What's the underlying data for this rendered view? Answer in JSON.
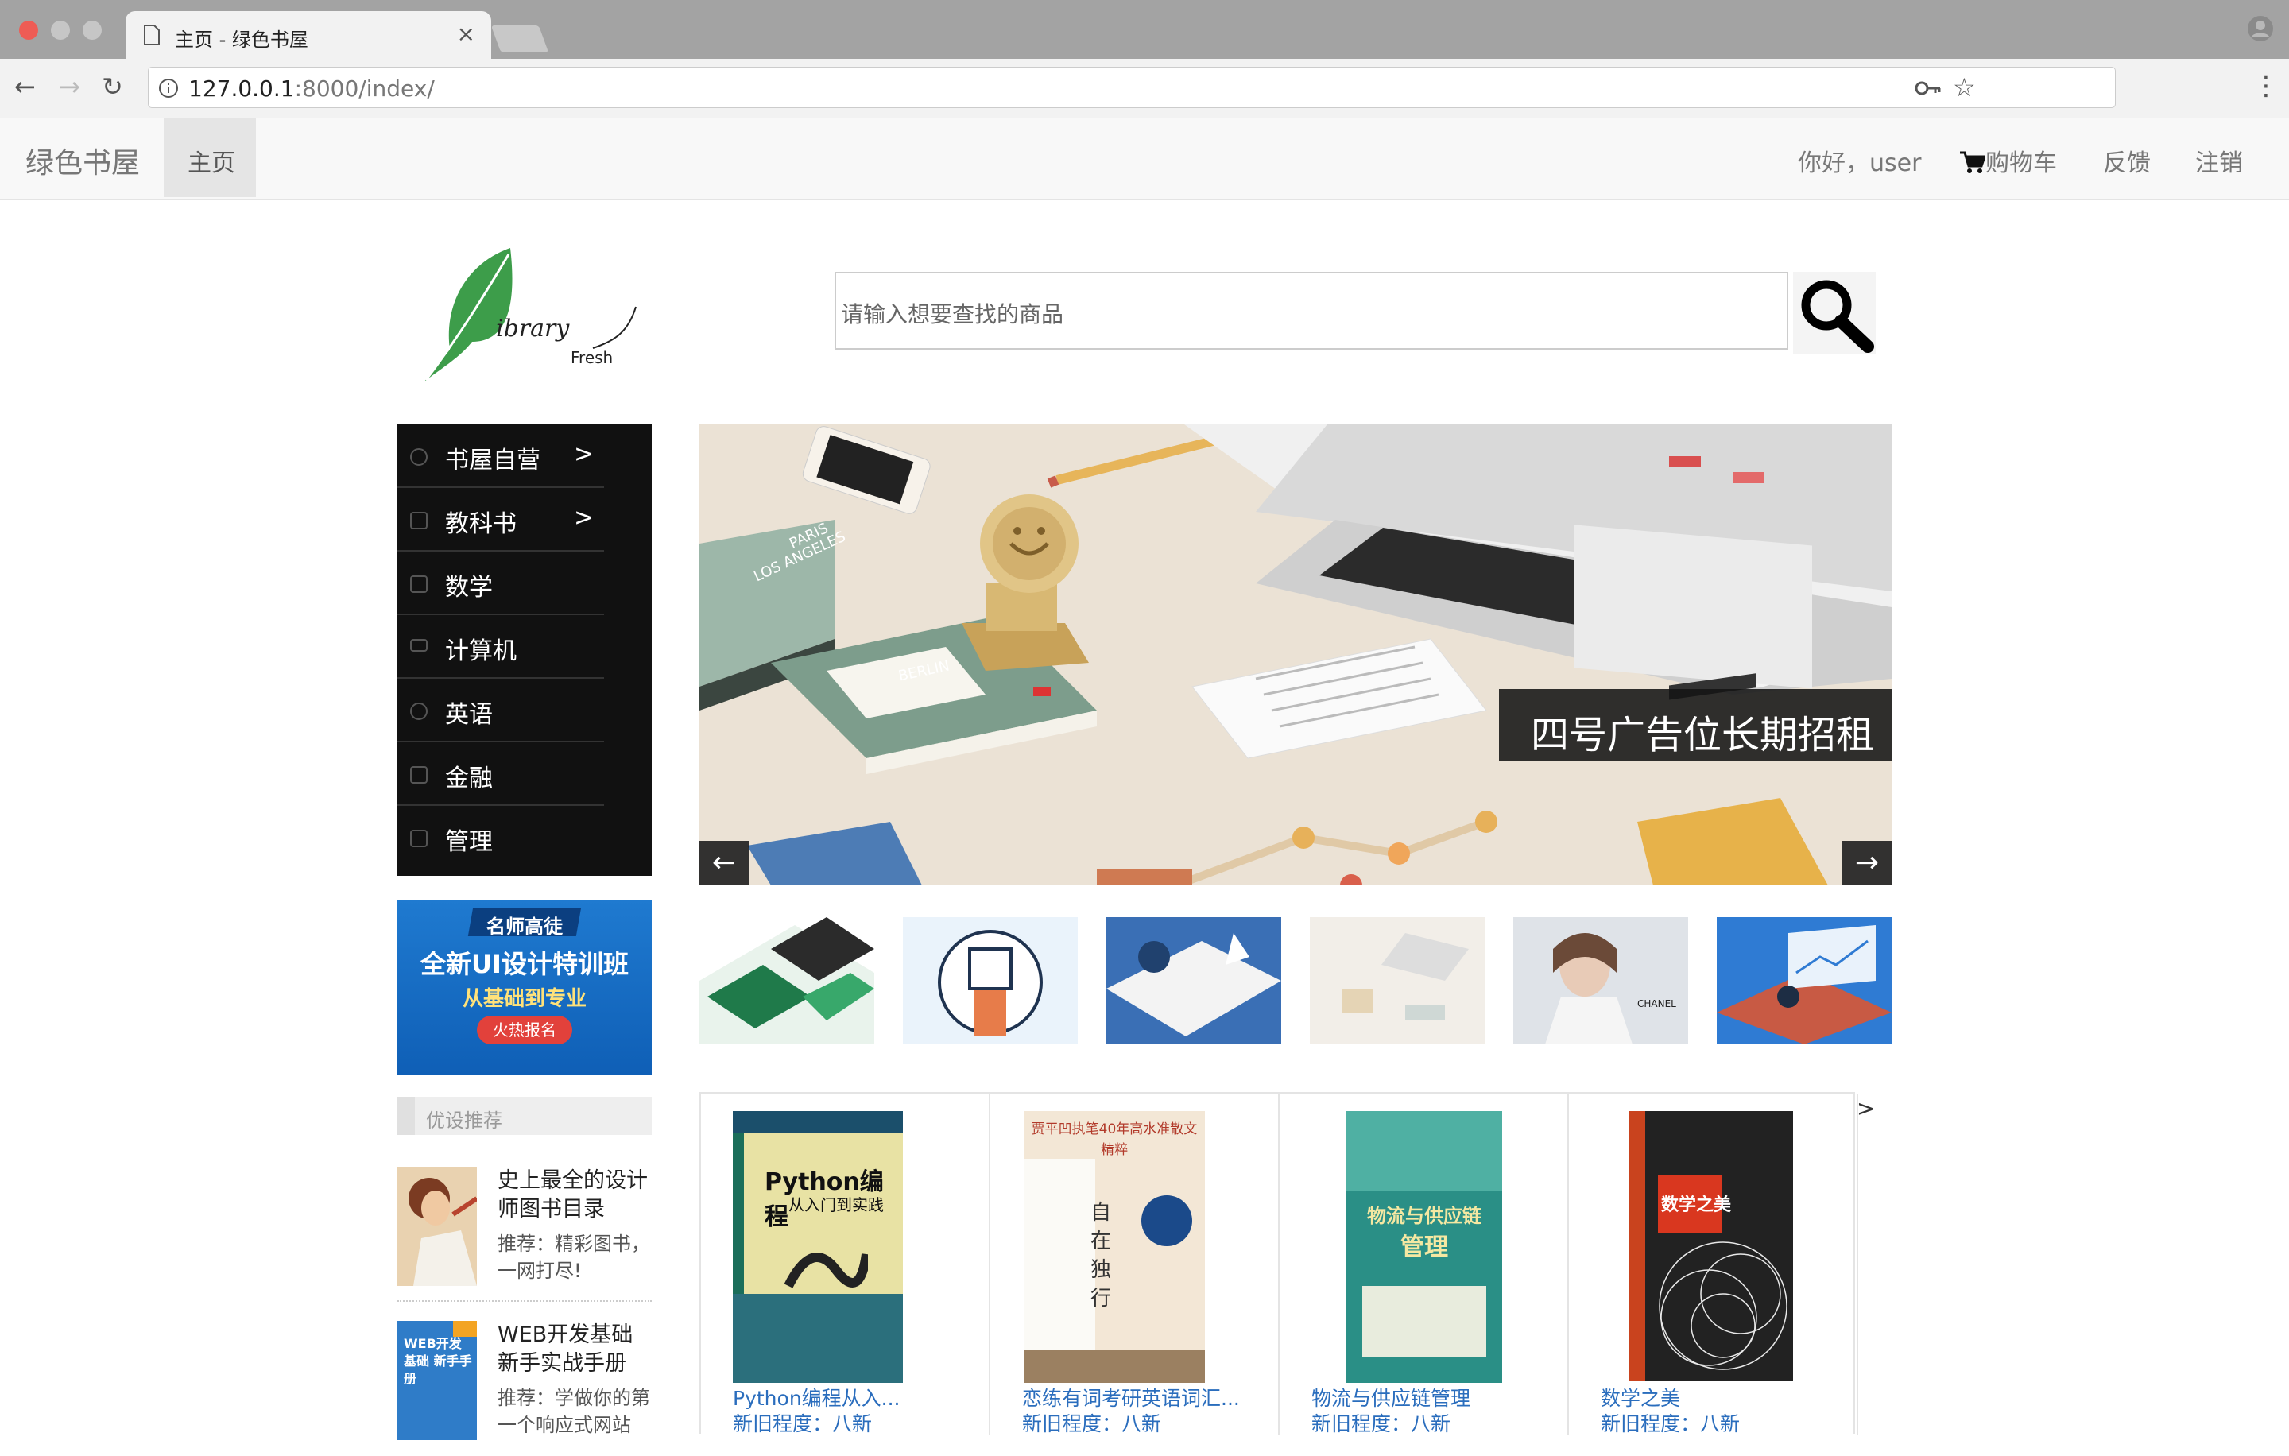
{
  "browser": {
    "tab_title": "主页 - 绿色书屋",
    "url_host": "127.0.0.1",
    "url_rest": ":8000/index/"
  },
  "navbar": {
    "brand": "绿色书屋",
    "home": "主页",
    "greeting": "你好，user",
    "cart": "购物车",
    "feedback": "反馈",
    "logout": "注销"
  },
  "logo": {
    "word": "ibrary",
    "sub": "Fresh"
  },
  "search": {
    "placeholder": "请输入想要查找的商品"
  },
  "categories": [
    {
      "label": "书屋自营",
      "arrow": ">"
    },
    {
      "label": "教科书",
      "arrow": ">"
    },
    {
      "label": "数学",
      "arrow": ""
    },
    {
      "label": "计算机",
      "arrow": ""
    },
    {
      "label": "英语",
      "arrow": ""
    },
    {
      "label": "金融",
      "arrow": ""
    },
    {
      "label": "管理",
      "arrow": ""
    }
  ],
  "promo": {
    "line1": "名师高徒",
    "line2": "全新UI设计特训班",
    "line3": "从基础到专业",
    "button": "火热报名"
  },
  "recommend": {
    "header": "优设推荐",
    "items": [
      {
        "title": "史上最全的设计师图书目录",
        "desc": "推荐：精彩图书，一网打尽!"
      },
      {
        "title": "WEB开发基础新手实战手册",
        "desc": "推荐：学做你的第一个响应式网站",
        "img_text": "WEB开发基础 新手手册"
      }
    ]
  },
  "carousel": {
    "caption": "四号广告位长期招租",
    "prev": "←",
    "next": "→",
    "scene_labels": [
      "PARIS",
      "LOS ANGELES",
      "BERLIN"
    ]
  },
  "thumbnails": [
    "web-design-mockups",
    "raised-hand",
    "isometric-desk",
    "office-items",
    "fashion-portrait",
    "business-chart"
  ],
  "thumb_text": {
    "chanel": "CHANEL"
  },
  "books": [
    {
      "title": "Python编程从入...",
      "cond": "新旧程度：八新",
      "cover_title": "Python编程",
      "cover_sub": "从入门到实践",
      "cover_bg": "#e8e2a4"
    },
    {
      "title": "恋练有词考研英语词汇...",
      "cond": "新旧程度：八新",
      "cover_title": "自在独行",
      "cover_sub": "贾平凹执笔40年高水准散文精粹",
      "cover_bg": "#f3e7d6"
    },
    {
      "title": "物流与供应链管理",
      "cond": "新旧程度：八新",
      "cover_title": "物流与供应链",
      "cover_sub": "管理",
      "cover_bg": "#2a8f86"
    },
    {
      "title": "数学之美",
      "cond": "新旧程度：八新",
      "cover_title": "数学之美",
      "cover_sub": "",
      "cover_bg": "#222"
    }
  ],
  "books_more": ">"
}
